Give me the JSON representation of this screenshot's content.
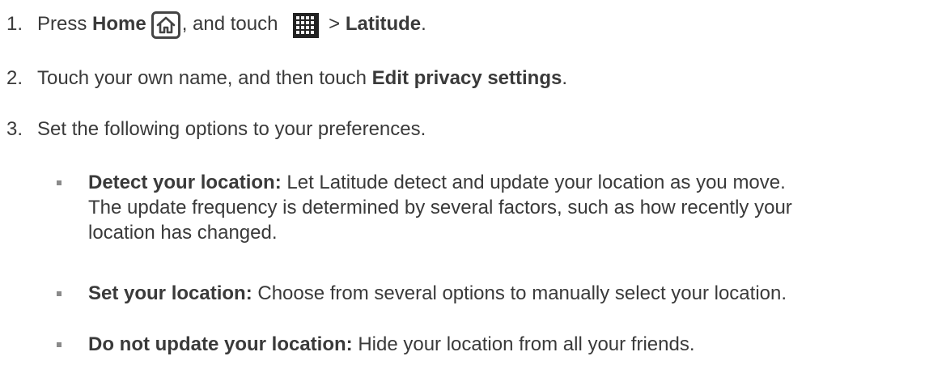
{
  "steps": [
    {
      "number": "1.",
      "parts": [
        "Press ",
        "Home",
        ", and touch ",
        "> ",
        "Latitude",
        "."
      ]
    },
    {
      "number": "2.",
      "parts": [
        "Touch your own name, and then touch ",
        "Edit privacy settings",
        "."
      ]
    },
    {
      "number": "3.",
      "text": "Set the following options to your preferences."
    }
  ],
  "options": [
    {
      "label": "Detect your location:",
      "description_lines": [
        "Let Latitude detect and update your location as you move.",
        "The update frequency is determined by several factors, such as how recently your",
        "location has changed."
      ]
    },
    {
      "label": "Set your location:",
      "description": "Choose from several options to manually select your location."
    },
    {
      "label": "Do not update your location:",
      "description": "Hide your location from all your friends."
    }
  ],
  "icons": {
    "home": "home-icon",
    "apps": "apps-grid-icon"
  }
}
